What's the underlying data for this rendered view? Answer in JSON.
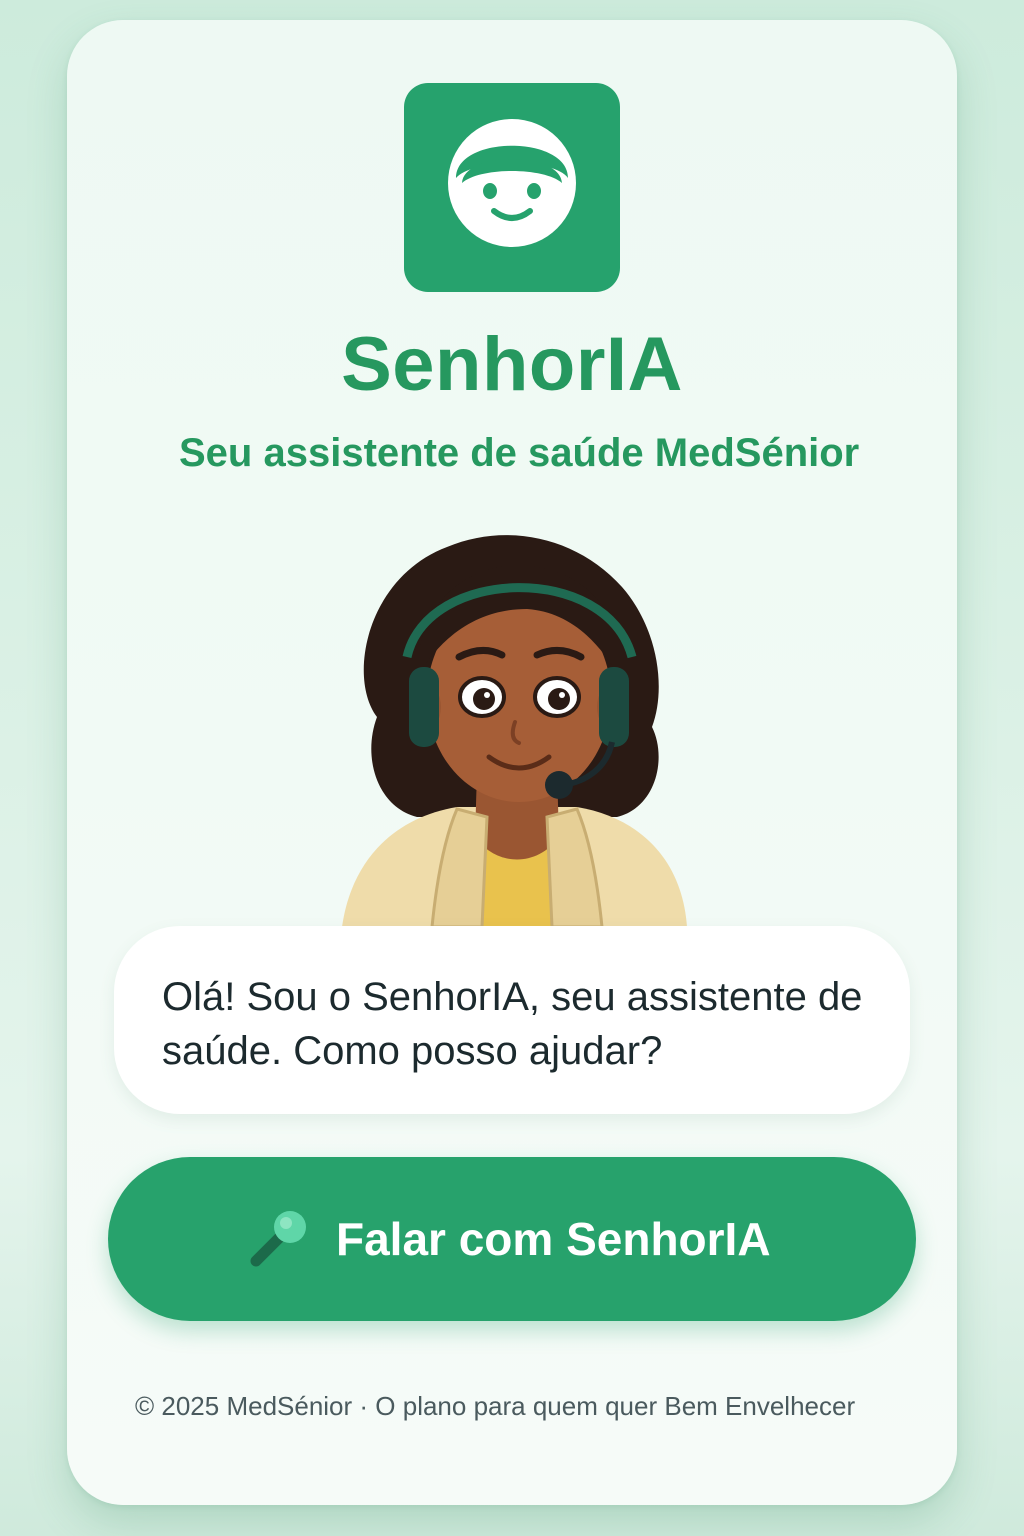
{
  "theme": {
    "accent": "#26a26d",
    "title_color": "#26985f",
    "background": "#d9f0e4",
    "card_background": "#f1faf5"
  },
  "header": {
    "logo_icon": "smiley-face-icon",
    "title": "SenhorIA",
    "subtitle": "Seu assistente de saúde MedSénior"
  },
  "assistant": {
    "avatar": "assistant-with-headset-avatar",
    "greeting": "Olá! Sou o SenhorIA, seu assistente de saúde. Como posso ajudar?"
  },
  "actions": {
    "talk_button_icon": "microphone-icon",
    "talk_button_label": "Falar com SenhorIA"
  },
  "footer": {
    "text": "© 2025 MedSénior · O plano para quem quer Bem Envelhecer"
  }
}
